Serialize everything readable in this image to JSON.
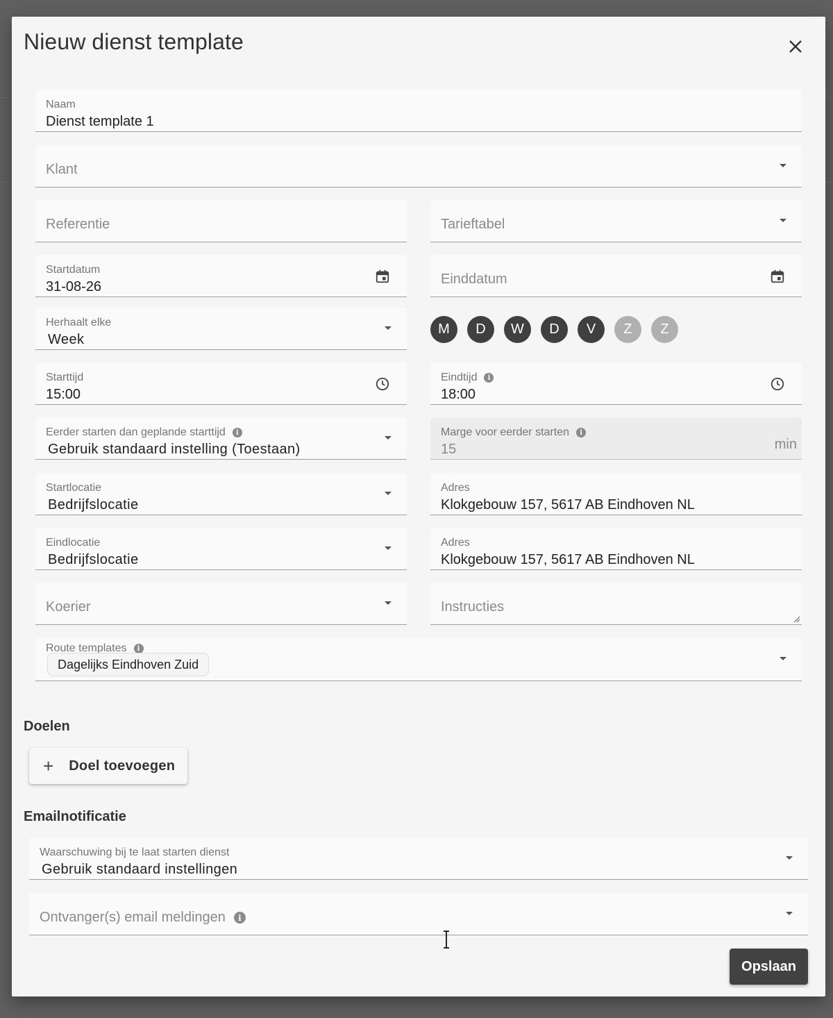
{
  "dialog": {
    "title": "Nieuw dienst template",
    "close_icon": "close-icon"
  },
  "form": {
    "naam": {
      "label": "Naam",
      "value": "Dienst template 1"
    },
    "klant": {
      "placeholder": "Klant"
    },
    "referentie": {
      "placeholder": "Referentie"
    },
    "tarieftabel": {
      "placeholder": "Tarieftabel"
    },
    "startdatum": {
      "label": "Startdatum",
      "value": "31-08-26"
    },
    "einddatum": {
      "placeholder": "Einddatum"
    },
    "herhaalt": {
      "label": "Herhaalt elke",
      "value": "Week"
    },
    "weekdays": [
      {
        "letter": "M",
        "active": true
      },
      {
        "letter": "D",
        "active": true
      },
      {
        "letter": "W",
        "active": true
      },
      {
        "letter": "D",
        "active": true
      },
      {
        "letter": "V",
        "active": true
      },
      {
        "letter": "Z",
        "active": false
      },
      {
        "letter": "Z",
        "active": false
      }
    ],
    "starttijd": {
      "label": "Starttijd",
      "value": "15:00"
    },
    "eindtijd": {
      "label": "Eindtijd",
      "value": "18:00"
    },
    "eerder_starten": {
      "label": "Eerder starten dan geplande starttijd",
      "value": "Gebruik standaard instelling (Toestaan)"
    },
    "marge": {
      "label": "Marge voor eerder starten",
      "value": "15",
      "suffix": "min"
    },
    "startlocatie": {
      "label": "Startlocatie",
      "value": "Bedrijfslocatie"
    },
    "start_adres": {
      "label": "Adres",
      "value": "Klokgebouw 157, 5617 AB Eindhoven NL"
    },
    "eindlocatie": {
      "label": "Eindlocatie",
      "value": "Bedrijfslocatie"
    },
    "eind_adres": {
      "label": "Adres",
      "value": "Klokgebouw 157, 5617 AB Eindhoven NL"
    },
    "koerier": {
      "placeholder": "Koerier"
    },
    "instructies": {
      "placeholder": "Instructies"
    },
    "route_templates": {
      "label": "Route templates",
      "chip": "Dagelijks Eindhoven Zuid"
    }
  },
  "doelen": {
    "title": "Doelen",
    "add_label": "Doel toevoegen"
  },
  "email": {
    "title": "Emailnotificatie",
    "waarschuwing": {
      "label": "Waarschuwing bij te laat starten dienst",
      "value": "Gebruik standaard instellingen"
    },
    "ontvangers": {
      "placeholder": "Ontvanger(s) email meldingen"
    }
  },
  "actions": {
    "save_label": "Opslaan"
  }
}
